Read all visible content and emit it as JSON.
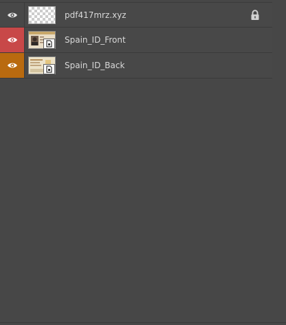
{
  "panel": {
    "layers": [
      {
        "name": "pdf417mrz.xyz",
        "visibility_color": "#484848",
        "thumbnail": "transparent-checker",
        "visibility_icon": "eye-icon",
        "locked": true,
        "lock_icon": "lock-icon"
      },
      {
        "name": "Spain_ID_Front",
        "visibility_color": "#c84848",
        "thumbnail": "id-card-front-smart-object",
        "visibility_icon": "eye-icon",
        "locked": false
      },
      {
        "name": "Spain_ID_Back",
        "visibility_color": "#b96a0f",
        "thumbnail": "id-card-back-smart-object",
        "visibility_icon": "eye-icon",
        "locked": false
      }
    ]
  }
}
